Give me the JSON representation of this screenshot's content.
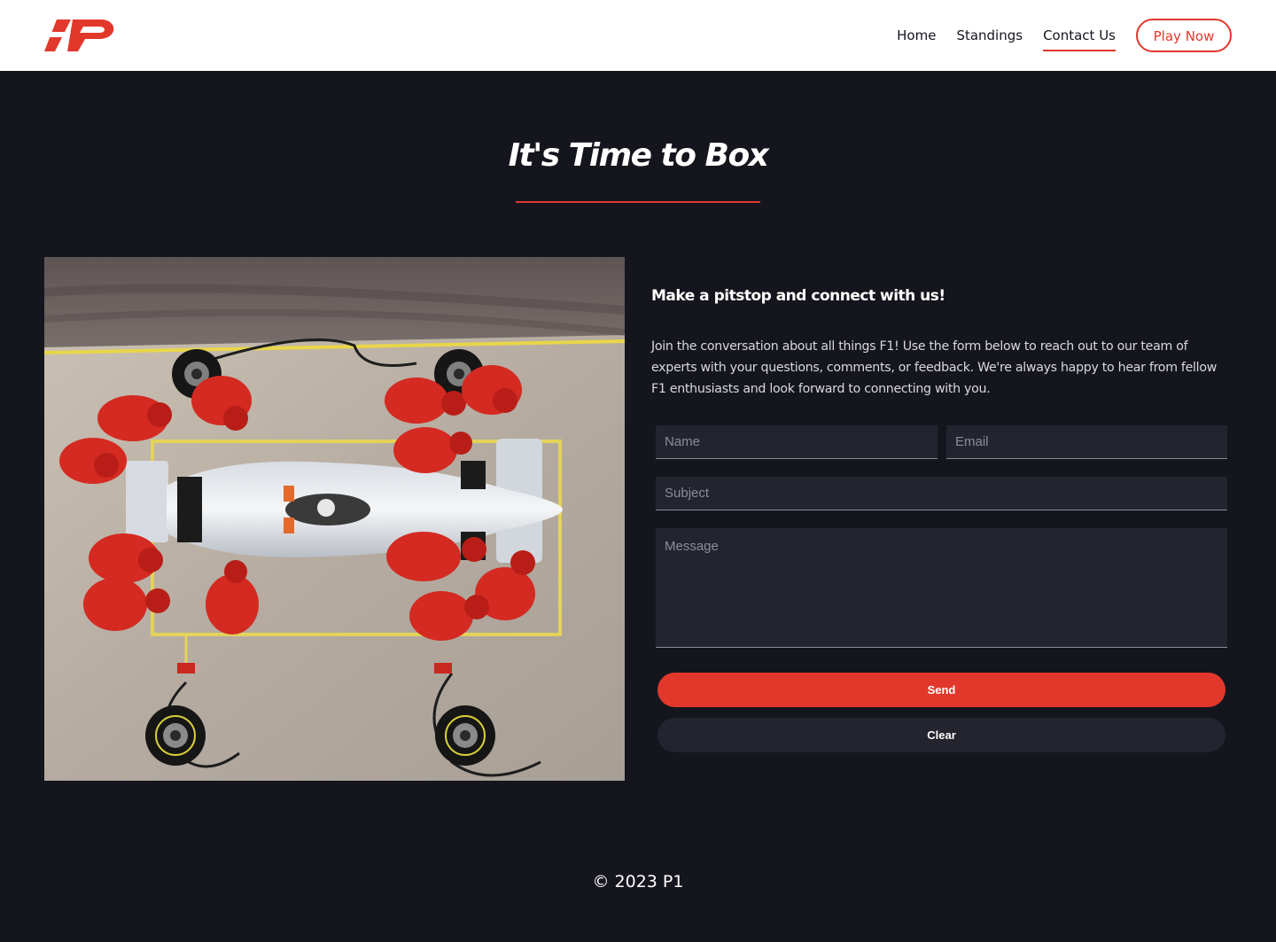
{
  "brand": {
    "logo_text": "P",
    "accent_color": "#e1382b",
    "dark_bg": "#15151e",
    "field_bg": "#24242f"
  },
  "nav": {
    "items": [
      {
        "label": "Home"
      },
      {
        "label": "Standings"
      },
      {
        "label": "Contact Us"
      }
    ],
    "active": "Contact Us",
    "cta_label": "Play Now"
  },
  "hero": {
    "title": "It's Time to Box"
  },
  "image": {
    "subject": "overhead pit-stop photo of a silver F1 car surrounded by red-suited pit crew"
  },
  "contact": {
    "heading": "Make a pitstop and connect with us!",
    "intro": "Join the conversation about all things F1! Use the form below to reach out to our team of experts with your questions, comments, or feedback. We're always happy to hear from fellow F1 enthusiasts and look forward to connecting with you.",
    "form": {
      "name_placeholder": "Name",
      "email_placeholder": "Email",
      "subject_placeholder": "Subject",
      "message_placeholder": "Message",
      "send_label": "Send",
      "clear_label": "Clear"
    }
  },
  "footer": {
    "text": "© 2023 P1"
  }
}
